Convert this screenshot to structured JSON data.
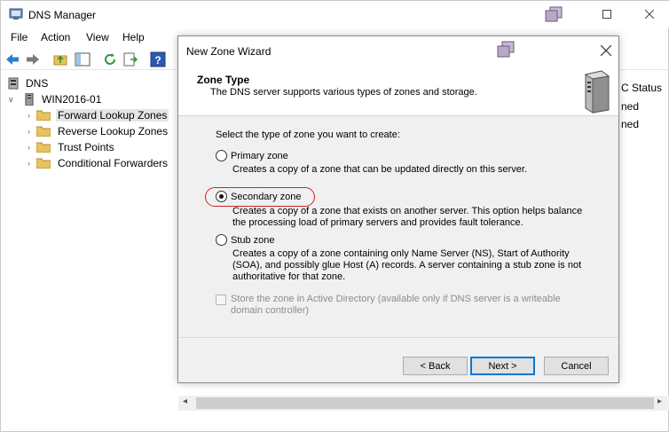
{
  "window": {
    "title": "DNS Manager"
  },
  "menu": [
    "File",
    "Action",
    "View",
    "Help"
  ],
  "tree": {
    "root": "DNS",
    "server": "WIN2016-01",
    "items": [
      {
        "label": "Forward Lookup Zones",
        "selected": true
      },
      {
        "label": "Reverse Lookup Zones",
        "selected": false
      },
      {
        "label": "Trust Points",
        "selected": false
      },
      {
        "label": "Conditional Forwarders",
        "selected": false
      }
    ]
  },
  "right_pane": {
    "status_header": "C Status",
    "row1": "ned",
    "row2": "ned"
  },
  "wizard": {
    "title": "New Zone Wizard",
    "header_title": "Zone Type",
    "header_subtitle": "The DNS server supports various types of zones and storage.",
    "prompt": "Select the type of zone you want to create:",
    "options": [
      {
        "label": "Primary zone",
        "description": "Creates a copy of a zone that can be updated directly on this server.",
        "selected": false
      },
      {
        "label": "Secondary zone",
        "description": "Creates a copy of a zone that exists on another server. This option helps balance the processing load of primary servers and provides fault tolerance.",
        "selected": true
      },
      {
        "label": "Stub zone",
        "description": "Creates a copy of a zone containing only Name Server (NS), Start of Authority (SOA), and possibly glue Host (A) records. A server containing a stub zone is not authoritative for that zone.",
        "selected": false
      }
    ],
    "ad_checkbox": {
      "label": "Store the zone in Active Directory (available only if DNS server is a writeable domain controller)",
      "checked": false,
      "enabled": false
    },
    "buttons": {
      "back": "< Back",
      "next": "Next >",
      "cancel": "Cancel"
    }
  },
  "colors": {
    "accent": "#0078d7",
    "highlight_oval": "#d62020",
    "folder": "#e8c25a"
  }
}
